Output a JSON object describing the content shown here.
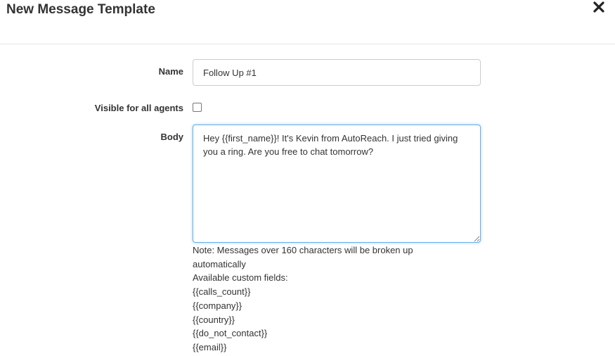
{
  "modal": {
    "title": "New Message Template"
  },
  "form": {
    "name_label": "Name",
    "name_value": "Follow Up #1",
    "visible_label": "Visible for all agents",
    "visible_checked": false,
    "body_label": "Body",
    "body_value": "Hey {{first_name}}! It's Kevin from AutoReach. I just tried giving you a ring. Are you free to chat tomorrow?"
  },
  "help": {
    "note": "Note: Messages over 160 characters will be broken up automatically",
    "fields_heading": "Available custom fields:",
    "custom_fields": [
      "{{calls_count}}",
      "{{company}}",
      "{{country}}",
      "{{do_not_contact}}",
      "{{email}}"
    ]
  },
  "icons": {
    "close": "close-icon",
    "resize": "resize-grip-icon"
  },
  "colors": {
    "focus_border": "#66afe9",
    "text": "#333333"
  }
}
